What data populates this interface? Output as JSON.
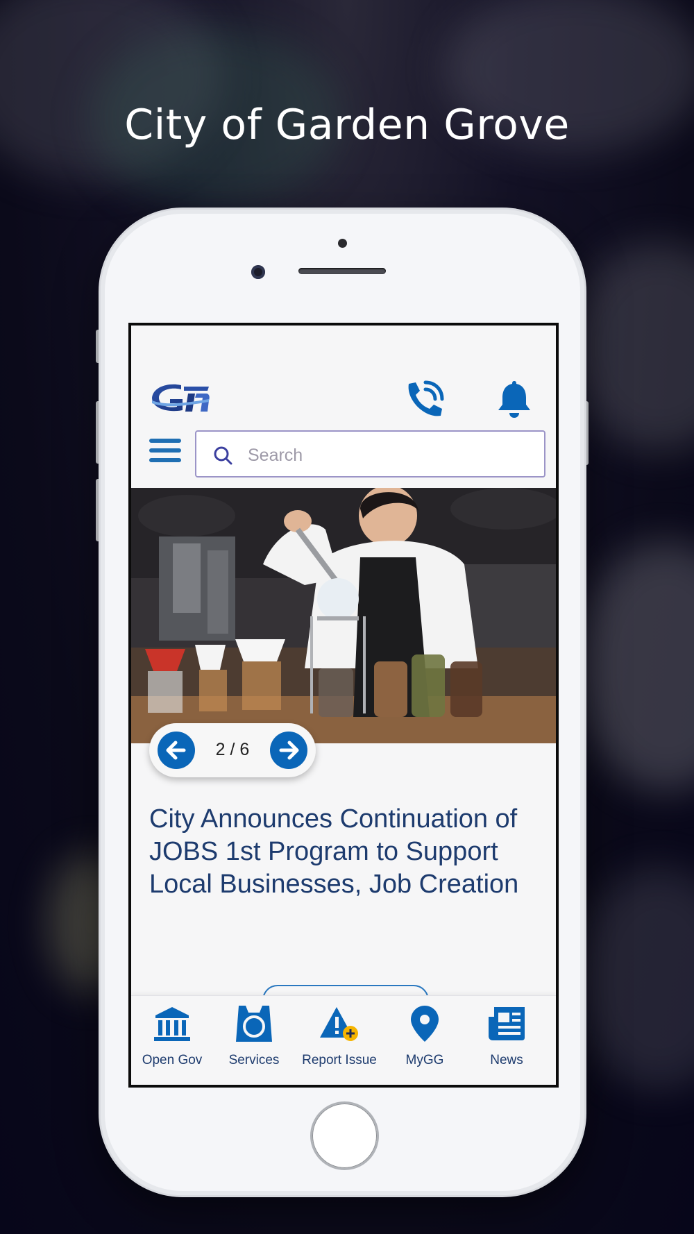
{
  "promo": {
    "headline": "City of Garden Grove"
  },
  "app": {
    "logo_text": "G",
    "header_icons": [
      "phone-icon",
      "bell-icon"
    ],
    "search": {
      "placeholder": "Search",
      "value": ""
    }
  },
  "carousel": {
    "counter": "2 / 6",
    "article_title": "City Announces Continuation of JOBS 1st Program to Support Local Businesses, Job Creation"
  },
  "bottom_nav": [
    {
      "label": "Open Gov",
      "icon": "building-icon"
    },
    {
      "label": "Services",
      "icon": "services-icon"
    },
    {
      "label": "Report Issue",
      "icon": "warning-icon"
    },
    {
      "label": "MyGG",
      "icon": "location-pin-icon"
    },
    {
      "label": "News",
      "icon": "newspaper-icon"
    }
  ],
  "colors": {
    "accent": "#0a66b8",
    "title_text": "#1d3b6e",
    "badge": "#f5b400"
  }
}
